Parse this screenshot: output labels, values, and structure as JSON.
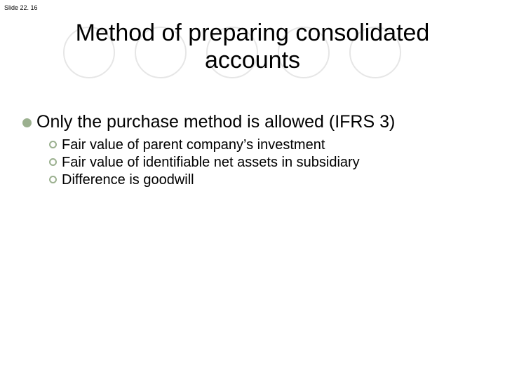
{
  "slideNumber": "Slide 22. 16",
  "title": "Method of preparing consolidated accounts",
  "mainBullet": "Only the purchase method is allowed (IFRS 3)",
  "subBullets": [
    "Fair value of parent company’s investment",
    "Fair value of identifiable net assets in subsidiary",
    "Difference is goodwill"
  ]
}
